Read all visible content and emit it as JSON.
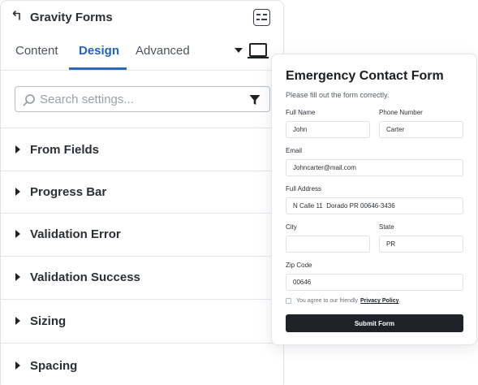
{
  "panel": {
    "title": "Gravity Forms",
    "icons": {
      "back": "back-arrow-icon",
      "collapse": "collapse-panel-icon",
      "device": "desktop-device-icon",
      "dropdown": "caret-down-icon",
      "search": "search-icon",
      "filter": "filter-icon"
    },
    "tabs": [
      {
        "label": "Content",
        "active": false
      },
      {
        "label": "Design",
        "active": true
      },
      {
        "label": "Advanced",
        "active": false
      }
    ],
    "search": {
      "placeholder": "Search settings...",
      "value": ""
    },
    "sections": [
      {
        "label": "From Fields"
      },
      {
        "label": "Progress Bar"
      },
      {
        "label": "Validation Error"
      },
      {
        "label": "Validation Success"
      },
      {
        "label": "Sizing"
      },
      {
        "label": "Spacing"
      }
    ],
    "accent_color": "#2b67c9"
  },
  "form": {
    "title": "Emergency Contact Form",
    "subtitle": "Please fill out the form correctly.",
    "fields": {
      "full_name": {
        "label": "Full Name",
        "value": "John"
      },
      "phone": {
        "label": "Phone Number",
        "value": "Carter"
      },
      "email": {
        "label": "Email",
        "value": "Johncarter@mail.com"
      },
      "address": {
        "label": "Full Address",
        "value": "N Calle 11  Dorado PR 00646-3436"
      },
      "city": {
        "label": "City",
        "value": ""
      },
      "state": {
        "label": "State",
        "value": "PR"
      },
      "zip": {
        "label": "Zip Code",
        "value": "00646"
      }
    },
    "consent": {
      "text": "You agree to our friendly",
      "link": "Privacy Policy",
      "suffix": ".",
      "checked": false
    },
    "submit_label": "Submit Form",
    "button_color": "#1f2329"
  }
}
